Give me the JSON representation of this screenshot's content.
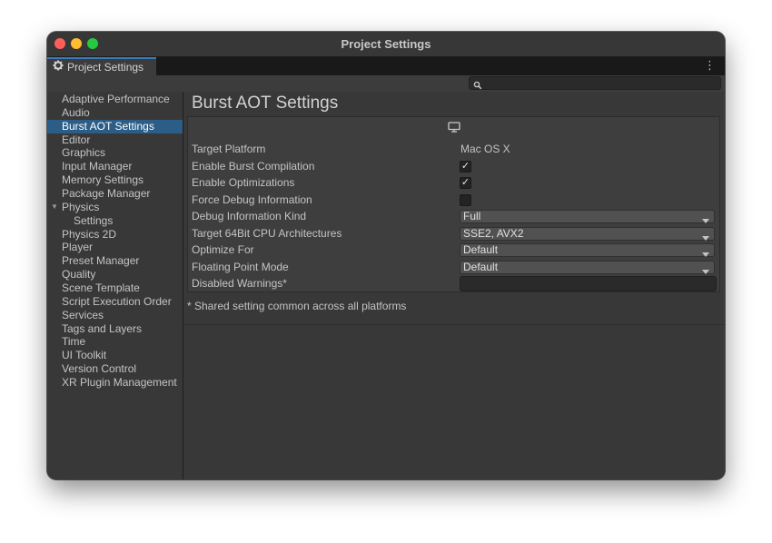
{
  "window": {
    "title": "Project Settings"
  },
  "tab": {
    "label": "Project Settings",
    "icon": "gear-icon"
  },
  "search": {
    "placeholder": ""
  },
  "sidebar": {
    "items": [
      {
        "label": "Adaptive Performance"
      },
      {
        "label": "Audio"
      },
      {
        "label": "Burst AOT Settings",
        "selected": true
      },
      {
        "label": "Editor"
      },
      {
        "label": "Graphics"
      },
      {
        "label": "Input Manager"
      },
      {
        "label": "Memory Settings"
      },
      {
        "label": "Package Manager"
      },
      {
        "label": "Physics",
        "expanded": true
      },
      {
        "label": "Settings",
        "child": true
      },
      {
        "label": "Physics 2D"
      },
      {
        "label": "Player"
      },
      {
        "label": "Preset Manager"
      },
      {
        "label": "Quality"
      },
      {
        "label": "Scene Template"
      },
      {
        "label": "Script Execution Order"
      },
      {
        "label": "Services"
      },
      {
        "label": "Tags and Layers"
      },
      {
        "label": "Time"
      },
      {
        "label": "UI Toolkit"
      },
      {
        "label": "Version Control"
      },
      {
        "label": "XR Plugin Management"
      }
    ]
  },
  "main": {
    "title": "Burst AOT Settings",
    "platform_icon": "monitor-icon",
    "rows": {
      "target_platform": {
        "label": "Target Platform",
        "value": "Mac OS X"
      },
      "enable_burst": {
        "label": "Enable Burst Compilation",
        "checked": true
      },
      "enable_opt": {
        "label": "Enable Optimizations",
        "checked": true
      },
      "force_debug": {
        "label": "Force Debug Information",
        "checked": false
      },
      "debug_kind": {
        "label": "Debug Information Kind",
        "value": "Full"
      },
      "cpu_arch": {
        "label": "Target 64Bit CPU Architectures",
        "value": "SSE2, AVX2"
      },
      "optimize_for": {
        "label": "Optimize For",
        "value": "Default"
      },
      "float_mode": {
        "label": "Floating Point Mode",
        "value": "Default"
      },
      "disabled_warnings": {
        "label": "Disabled Warnings*",
        "value": ""
      }
    },
    "footnote": "* Shared setting common across all platforms"
  },
  "check_glyph": "✓",
  "colors": {
    "selection": "#2c5d87",
    "tab_accent": "#3a79bb"
  }
}
